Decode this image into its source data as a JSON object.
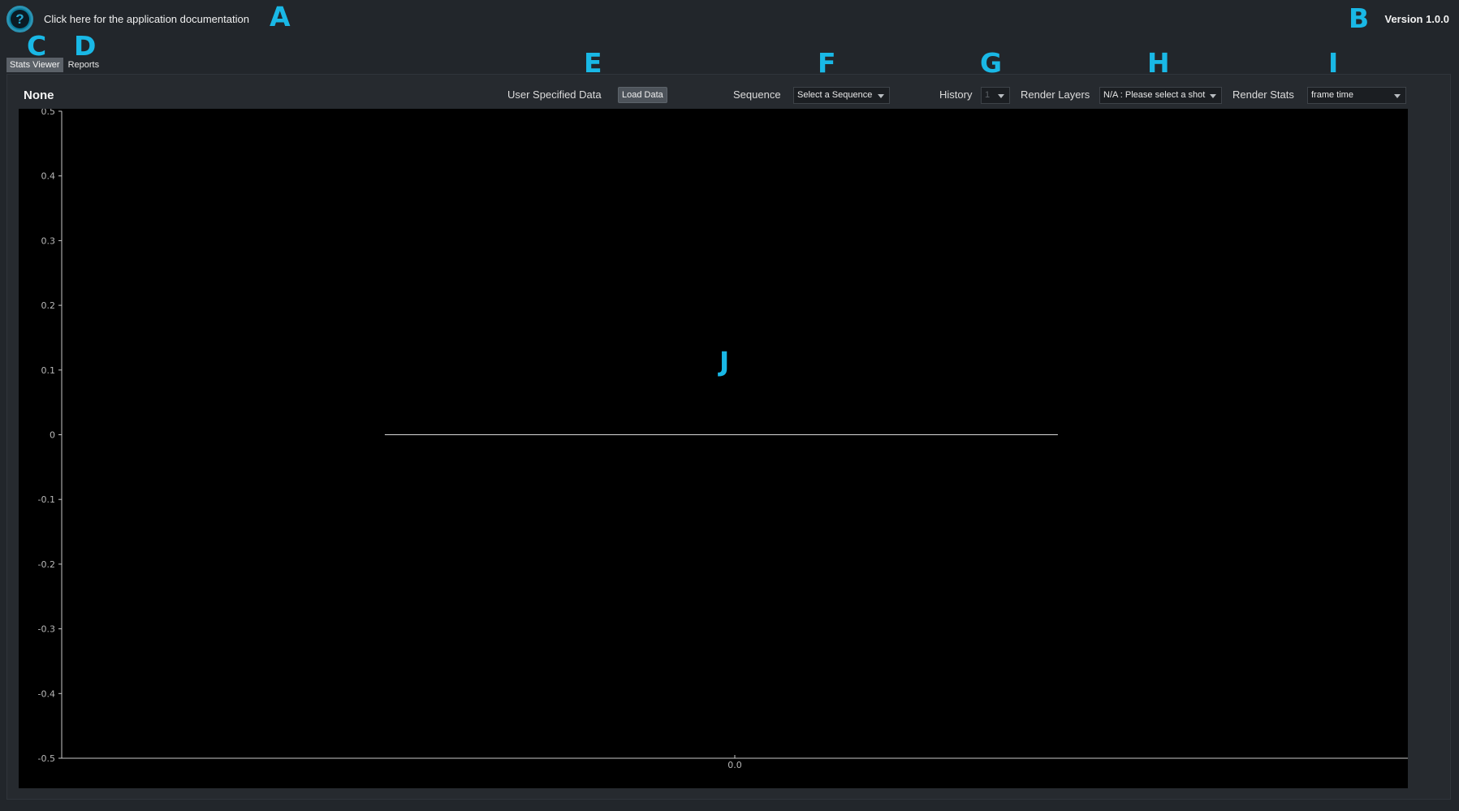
{
  "header": {
    "help_label": "?",
    "doc_link": "Click here for the application documentation",
    "version": "Version 1.0.0"
  },
  "tabs": [
    {
      "label": "Stats Viewer",
      "active": true
    },
    {
      "label": "Reports",
      "active": false
    }
  ],
  "panel": {
    "shot_title": "None",
    "user_data_label": "User Specified Data",
    "load_button": "Load Data",
    "sequence_label": "Sequence",
    "sequence_value": "Select a Sequence",
    "history_label": "History",
    "history_value": "1",
    "render_layers_label": "Render Layers",
    "render_layers_value": "N/A : Please select a shot",
    "render_stats_label": "Render Stats",
    "render_stats_value": "frame time"
  },
  "annotations": [
    "A",
    "B",
    "C",
    "D",
    "E",
    "F",
    "G",
    "H",
    "I",
    "J"
  ],
  "colors": {
    "background": "#22262b",
    "panel": "#262a2f",
    "plot_background": "#000000",
    "accent": "#19b8e6",
    "axis": "#c8c8c8"
  },
  "chart_data": {
    "type": "line",
    "title": "",
    "xlabel": "",
    "ylabel": "",
    "x_ticks": [
      "0.0"
    ],
    "y_ticks": [
      "0.5",
      "0.4",
      "0.3",
      "0.2",
      "0.1",
      "0",
      "-0.1",
      "-0.2",
      "-0.3",
      "-0.4",
      "-0.5"
    ],
    "ylim": [
      -0.5,
      0.5
    ],
    "xlim": [
      -0.5,
      0.5
    ],
    "series": [
      {
        "values": [
          {
            "x": -0.26,
            "y": 0
          },
          {
            "x": 0.24,
            "y": 0
          }
        ]
      }
    ],
    "grid": false,
    "legend": "none"
  }
}
